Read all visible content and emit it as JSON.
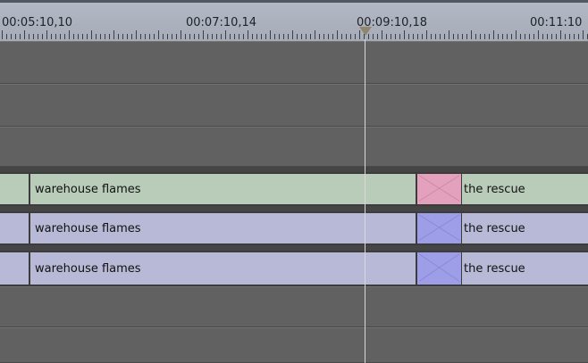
{
  "ruler": {
    "timecodes": [
      "00:05:10,10",
      "00:07:10,14",
      "00:09:10,18",
      "00:11:10"
    ]
  },
  "tracks": [
    {
      "type": "empty"
    },
    {
      "type": "empty"
    },
    {
      "type": "empty"
    },
    {
      "type": "video",
      "clip_a": "warehouse flames",
      "clip_b": "the rescue",
      "transition": "cross-dissolve"
    },
    {
      "type": "audio",
      "clip_a": "warehouse flames",
      "clip_b": "the rescue",
      "transition": "cross-fade"
    },
    {
      "type": "audio",
      "clip_a": "warehouse flames",
      "clip_b": "the rescue",
      "transition": "cross-fade"
    },
    {
      "type": "empty"
    },
    {
      "type": "empty"
    }
  ],
  "colors": {
    "video_clip": "#b8ccb9",
    "audio_clip": "#b7b9d6",
    "video_transition": "#e3a1bd",
    "audio_transition": "#9e9de7",
    "empty_track": "#616161"
  },
  "icons": {
    "playhead": "playhead-marker-icon",
    "transition": "transition-x-icon"
  }
}
